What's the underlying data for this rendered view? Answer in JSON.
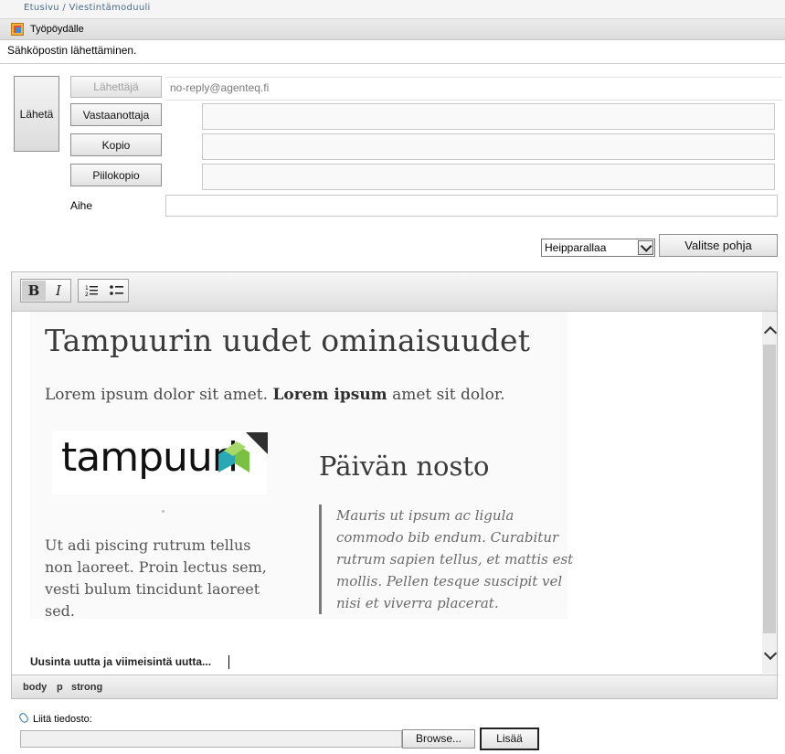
{
  "breadcrumb": "Etusivu / Viestintämoduuli",
  "toolbar": {
    "desktop_label": "Työpöydälle"
  },
  "page": {
    "heading": "Sähköpostin lähettäminen."
  },
  "form": {
    "send_label": "Lähetä",
    "sender_label": "Lähettäjä",
    "sender_value": "no-reply@agenteq.fi",
    "recipient_label": "Vastaanottaja",
    "cc_label": "Kopio",
    "bcc_label": "Piilokopio",
    "subject_label": "Aihe",
    "template_selected": "Heipparallaa",
    "choose_template_label": "Valitse pohja"
  },
  "editor": {
    "bold_label": "B",
    "italic_label": "I",
    "content": {
      "title": "Tampuurin uudet ominaisuudet",
      "intro_pre": "Lorem ipsum dolor sit amet.",
      "intro_bold": "Lorem ipsum",
      "intro_post": "amet sit dolor.",
      "logo_text": "tampuuri",
      "body_text": "Ut adi piscing rutrum tellus non laoreet. Proin lectus sem, vesti bulum tincidunt laoreet sed.",
      "day_heading": "Päivän nosto",
      "quote": "Mauris ut ipsum ac ligula commodo bib endum. Curabitur rutrum sapien tellus, et mattis est mollis. Pellen tesque suscipit vel nisi et viverra placerat.",
      "latest_line": "Uusinta uutta ja viimeisintä uutta..."
    },
    "path": [
      "body",
      "p",
      "strong"
    ]
  },
  "attachment": {
    "label": "Liitä tiedosto:",
    "browse_label": "Browse...",
    "add_label": "Lisää"
  },
  "colors": {
    "link_blue": "#4a6a8a",
    "logo_green": "#7ac143",
    "logo_teal": "#2aa7b5"
  }
}
